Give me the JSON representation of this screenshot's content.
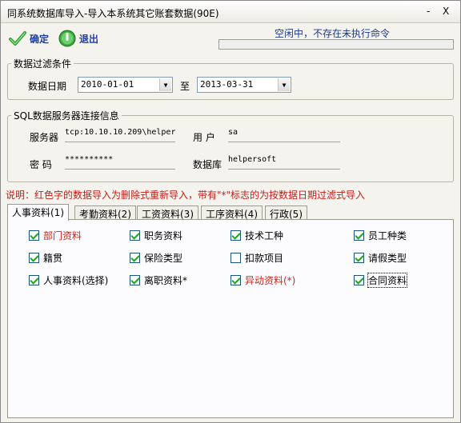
{
  "window": {
    "title": "同系统数据库导入-导入本系统其它账套数据(90E)",
    "minimize_glyph": "-",
    "close_glyph": "X"
  },
  "toolbar": {
    "confirm_label": "确定",
    "exit_label": "退出",
    "status_message": "空闲中，不存在未执行命令",
    "confirm_icon": "green-check-icon",
    "exit_icon": "green-power-icon"
  },
  "date_filter": {
    "legend": "数据过滤条件",
    "date_label": "数据日期",
    "start_date": "2010-01-01",
    "to_label": "至",
    "end_date": "2013-03-31"
  },
  "sql_server": {
    "legend": "SQL数据服务器连接信息",
    "server_label": "服务器",
    "server_value": "tcp:10.10.10.209\\helper",
    "user_label": "用 户",
    "user_value": "sa",
    "password_label": "密 码",
    "password_value": "**********",
    "database_label": "数据库",
    "database_value": "helpersoft"
  },
  "note": "说明：红色字的数据导入为删除式重新导入，带有\"*\"标志的为按数据日期过滤式导入",
  "tabs": [
    {
      "label": "人事资料(1)",
      "active": true
    },
    {
      "label": "考勤资料(2)",
      "active": false
    },
    {
      "label": "工资资料(3)",
      "active": false
    },
    {
      "label": "工序资料(4)",
      "active": false
    },
    {
      "label": "行政(5)",
      "active": false
    }
  ],
  "checkboxes": [
    {
      "label": "部门资料",
      "checked": true,
      "red": true
    },
    {
      "label": "职务资料",
      "checked": true,
      "red": false
    },
    {
      "label": "技术工种",
      "checked": true,
      "red": false
    },
    {
      "label": "员工种类",
      "checked": true,
      "red": false
    },
    {
      "label": "籍贯",
      "checked": true,
      "red": false
    },
    {
      "label": "保险类型",
      "checked": true,
      "red": false
    },
    {
      "label": "扣款项目",
      "checked": false,
      "red": false
    },
    {
      "label": "请假类型",
      "checked": true,
      "red": false
    },
    {
      "label": "人事资料(选择)",
      "checked": true,
      "red": false
    },
    {
      "label": "离职资料*",
      "checked": true,
      "red": false
    },
    {
      "label": "异动资料(*)",
      "checked": true,
      "red": true
    },
    {
      "label": "合同资料",
      "checked": true,
      "red": false
    }
  ],
  "colors": {
    "toolbar_text": "#1f3fa0",
    "status_text": "#1d3a8c",
    "note_red": "#c0201a",
    "check_green": "#21a121"
  }
}
